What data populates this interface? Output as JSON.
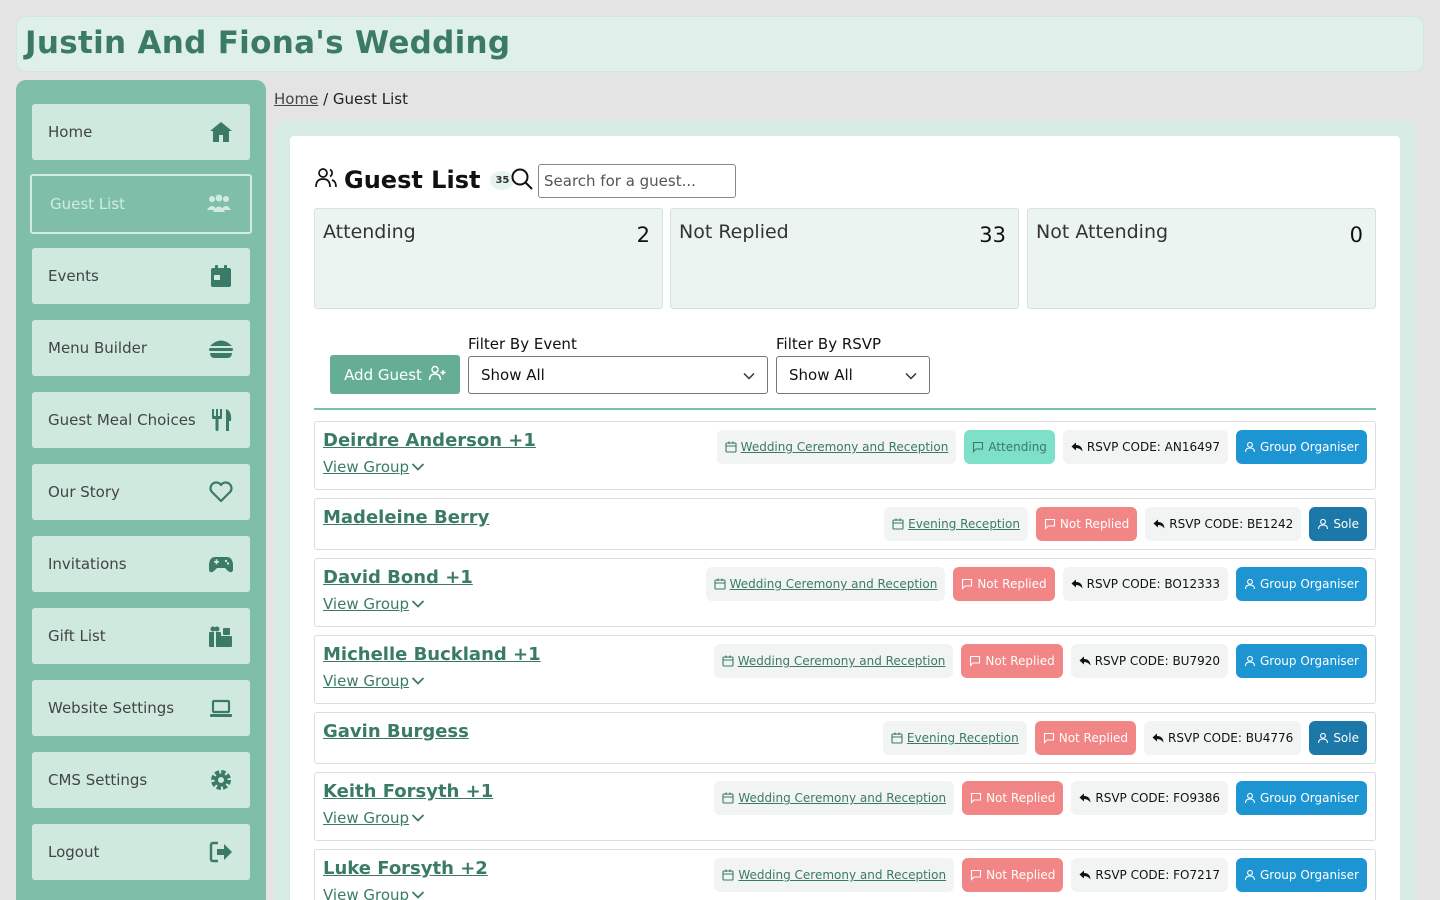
{
  "site": {
    "title": "Justin And Fiona's Wedding"
  },
  "nav": {
    "items": [
      {
        "label": "Home",
        "icon": "home-icon"
      },
      {
        "label": "Guest List",
        "icon": "users-icon",
        "active": true
      },
      {
        "label": "Events",
        "icon": "calendar-icon"
      },
      {
        "label": "Menu Builder",
        "icon": "burger-icon"
      },
      {
        "label": "Guest Meal Choices",
        "icon": "utensils-icon"
      },
      {
        "label": "Our Story",
        "icon": "heart-icon"
      },
      {
        "label": "Invitations",
        "icon": "gamepad-icon"
      },
      {
        "label": "Gift List",
        "icon": "gifts-icon"
      },
      {
        "label": "Website Settings",
        "icon": "laptop-icon"
      },
      {
        "label": "CMS Settings",
        "icon": "gear-icon"
      },
      {
        "label": "Logout",
        "icon": "logout-icon"
      }
    ]
  },
  "breadcrumb": {
    "home": "Home",
    "sep": "/",
    "current": "Guest List"
  },
  "page": {
    "title": "Guest List",
    "count": "35",
    "search_placeholder": "Search for a guest..."
  },
  "stats": [
    {
      "label": "Attending",
      "value": "2"
    },
    {
      "label": "Not Replied",
      "value": "33"
    },
    {
      "label": "Not Attending",
      "value": "0"
    }
  ],
  "controls": {
    "add_guest": "Add Guest",
    "filter_event_label": "Filter By Event",
    "filter_event_value": "Show All",
    "filter_rsvp_label": "Filter By RSVP",
    "filter_rsvp_value": "Show All",
    "view_group": "View Group"
  },
  "guests": [
    {
      "name": "Deirdre Anderson +1",
      "event": "Wedding Ceremony and Reception",
      "status": "Attending",
      "code": "RSVP CODE: AN16497",
      "role": "Group Organiser",
      "group": true
    },
    {
      "name": "Madeleine Berry",
      "event": "Evening Reception",
      "status": "Not Replied",
      "code": "RSVP CODE: BE1242",
      "role": "Sole",
      "group": false
    },
    {
      "name": "David Bond +1",
      "event": "Wedding Ceremony and Reception",
      "status": "Not Replied",
      "code": "RSVP CODE: BO12333",
      "role": "Group Organiser",
      "group": true
    },
    {
      "name": "Michelle Buckland +1",
      "event": "Wedding Ceremony and Reception",
      "status": "Not Replied",
      "code": "RSVP CODE: BU7920",
      "role": "Group Organiser",
      "group": true
    },
    {
      "name": "Gavin Burgess",
      "event": "Evening Reception",
      "status": "Not Replied",
      "code": "RSVP CODE: BU4776",
      "role": "Sole",
      "group": false
    },
    {
      "name": "Keith Forsyth +1",
      "event": "Wedding Ceremony and Reception",
      "status": "Not Replied",
      "code": "RSVP CODE: FO9386",
      "role": "Group Organiser",
      "group": true
    },
    {
      "name": "Luke Forsyth +2",
      "event": "Wedding Ceremony and Reception",
      "status": "Not Replied",
      "code": "RSVP CODE: FO7217",
      "role": "Group Organiser",
      "group": true
    }
  ]
}
